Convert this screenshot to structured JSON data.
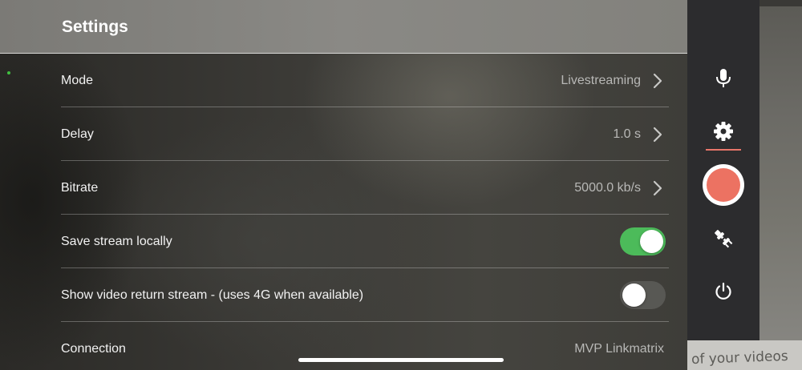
{
  "header": {
    "title": "Settings"
  },
  "settings": {
    "mode": {
      "label": "Mode",
      "value": "Livestreaming"
    },
    "delay": {
      "label": "Delay",
      "value": "1.0 s"
    },
    "bitrate": {
      "label": "Bitrate",
      "value": "5000.0 kb/s"
    },
    "save_locally": {
      "label": "Save stream locally",
      "enabled": true
    },
    "return_stream": {
      "label": "Show video return stream - (uses 4G when available)",
      "enabled": false
    },
    "connection": {
      "label": "Connection",
      "value": "MVP Linkmatrix"
    }
  },
  "sidebar": {
    "icons": [
      "microphone-icon",
      "gear-icon",
      "record-button",
      "plug-icon",
      "power-icon"
    ],
    "active": "gear-icon"
  },
  "background_text": "of your videos",
  "colors": {
    "accent": "#ec7262",
    "toggle_on": "#4cbb5a"
  }
}
